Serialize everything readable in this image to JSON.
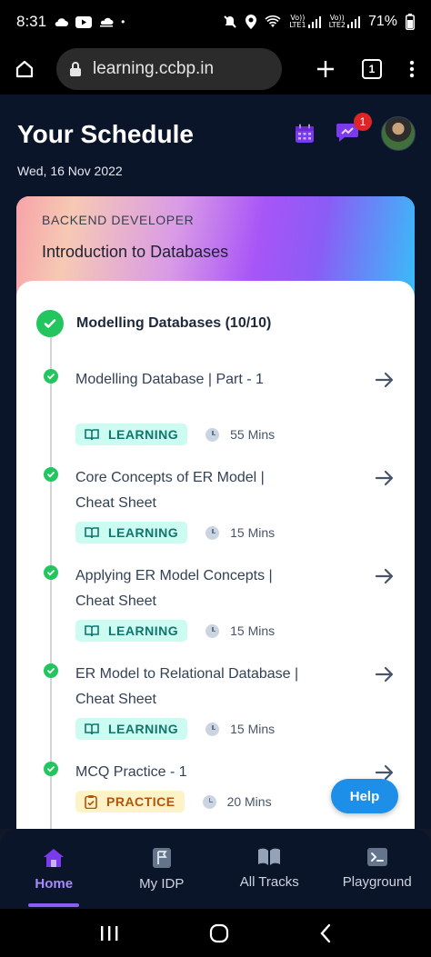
{
  "status_bar": {
    "time": "8:31",
    "battery": "71%",
    "sim1": "LTE1",
    "sim2": "LTE2",
    "volte": "Vo))"
  },
  "browser": {
    "url": "learning.ccbp.in",
    "tab_count": "1"
  },
  "header": {
    "title": "Your Schedule",
    "date": "Wed, 16 Nov 2022",
    "notification_count": "1"
  },
  "course": {
    "track": "BACKEND DEVELOPER",
    "title": "Introduction to Databases",
    "module_title": "Modelling Databases (10/10)",
    "items": [
      {
        "title": "Modelling Database | Part - 1",
        "tag": "LEARNING",
        "duration": "55 Mins"
      },
      {
        "title": "Core Concepts of ER Model | Cheat Sheet",
        "tag": "LEARNING",
        "duration": "15 Mins"
      },
      {
        "title": "Applying ER Model Concepts | Cheat Sheet",
        "tag": "LEARNING",
        "duration": "15 Mins"
      },
      {
        "title": "ER Model to Relational Database | Cheat Sheet",
        "tag": "LEARNING",
        "duration": "15 Mins"
      },
      {
        "title": "MCQ Practice - 1",
        "tag": "PRACTICE",
        "duration": "20 Mins"
      }
    ]
  },
  "help_label": "Help",
  "nav": [
    {
      "label": "Home",
      "icon": "home-icon",
      "active": true
    },
    {
      "label": "My IDP",
      "icon": "flag-icon",
      "active": false
    },
    {
      "label": "All Tracks",
      "icon": "book-icon",
      "active": false
    },
    {
      "label": "Playground",
      "icon": "terminal-icon",
      "active": false
    }
  ],
  "colors": {
    "accent": "#8b5cf6",
    "success": "#22c55e",
    "help": "#1d8fe8",
    "header_bg": "#0b1529"
  }
}
